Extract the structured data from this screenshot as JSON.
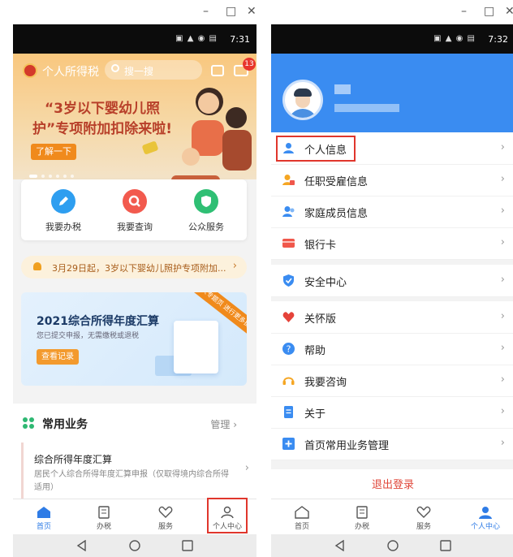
{
  "window_controls": {
    "minimize": "–",
    "maximize": "□",
    "close": "✕"
  },
  "phone1": {
    "status_time": "7:31",
    "app_title": "个人所得税",
    "search_placeholder": "搜一搜",
    "message_badge": "13",
    "banner": {
      "title": "“3岁以下婴幼儿照护”专项附加扣除来啦!",
      "button": "了解一下"
    },
    "quick_actions": [
      {
        "label": "我要办税",
        "icon": "edit-icon",
        "color": "#2e9ef0"
      },
      {
        "label": "我要查询",
        "icon": "search-icon",
        "color": "#f25a4e"
      },
      {
        "label": "公众服务",
        "icon": "shield-icon",
        "color": "#2fbf74"
      }
    ],
    "notice": "3月29日起，3岁以下婴幼儿照护专项附加...",
    "annual_card": {
      "title": "2021综合所得年度汇算",
      "subtitle": "您已提交申报，无需缴税或退税",
      "button": "查看记录",
      "ribbon": "进入专题页 进行更多操作"
    },
    "common_business": {
      "title": "常用业务",
      "manage": "管理",
      "item_title": "综合所得年度汇算",
      "item_desc": "居民个人综合所得年度汇算申报（仅取得境内综合所得适用）"
    },
    "tabs": [
      {
        "label": "首页",
        "icon": "home-icon",
        "active": true
      },
      {
        "label": "办税",
        "icon": "document-icon",
        "active": false
      },
      {
        "label": "服务",
        "icon": "heart-icon",
        "active": false
      },
      {
        "label": "个人中心",
        "icon": "person-icon",
        "active": false
      }
    ]
  },
  "phone2": {
    "status_time": "7:32",
    "menu_groups": [
      [
        {
          "label": "个人信息",
          "icon": "person-icon",
          "color": "#3a8cf1"
        },
        {
          "label": "任职受雇信息",
          "icon": "employee-icon",
          "color": "#f5a623"
        },
        {
          "label": "家庭成员信息",
          "icon": "family-icon",
          "color": "#3a8cf1"
        },
        {
          "label": "银行卡",
          "icon": "bank-card-icon",
          "color": "#f0574b"
        }
      ],
      [
        {
          "label": "安全中心",
          "icon": "shield-icon",
          "color": "#3a8cf1"
        }
      ],
      [
        {
          "label": "关怀版",
          "icon": "heart-icon",
          "color": "#e5433a"
        },
        {
          "label": "帮助",
          "icon": "question-icon",
          "color": "#3a8cf1"
        },
        {
          "label": "我要咨询",
          "icon": "headset-icon",
          "color": "#f5a623"
        },
        {
          "label": "关于",
          "icon": "document-icon",
          "color": "#3a8cf1"
        },
        {
          "label": "首页常用业务管理",
          "icon": "plus-icon",
          "color": "#3a8cf1"
        }
      ]
    ],
    "logout": "退出登录",
    "tabs": [
      {
        "label": "首页",
        "icon": "home-icon",
        "active": false
      },
      {
        "label": "办税",
        "icon": "document-icon",
        "active": false
      },
      {
        "label": "服务",
        "icon": "heart-icon",
        "active": false
      },
      {
        "label": "个人中心",
        "icon": "person-icon",
        "active": true
      }
    ]
  }
}
